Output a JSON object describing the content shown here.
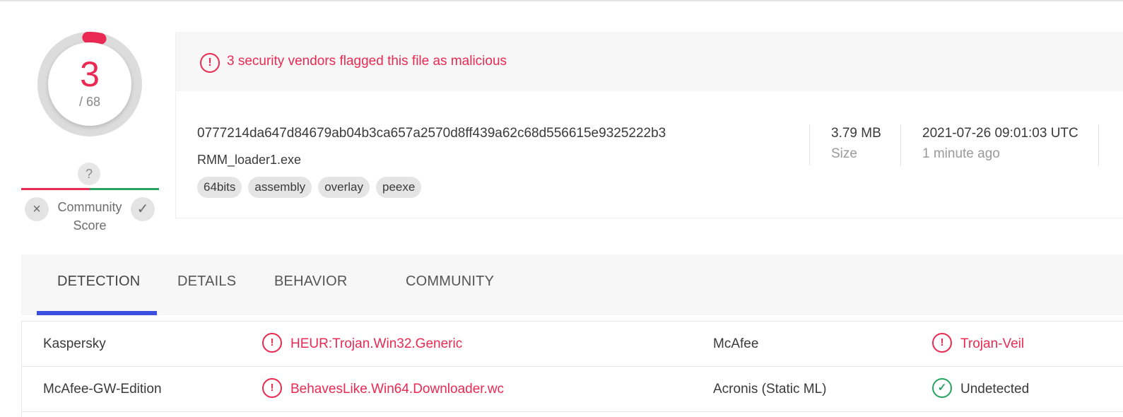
{
  "score": {
    "detected": "3",
    "total": "/ 68",
    "detected_fraction": 0.044
  },
  "community": {
    "question_mark": "?",
    "label_line1": "Community",
    "label_line2": "Score",
    "downvote_icon": "×",
    "upvote_icon": "✓"
  },
  "alert": {
    "icon": "!",
    "text": "3 security vendors flagged this file as malicious"
  },
  "file": {
    "hash": "0777214da647d84679ab04b3ca657a2570d8ff439a62c68d556615e9325222b3",
    "name": "RMM_loader1.exe",
    "tags": [
      "64bits",
      "assembly",
      "overlay",
      "peexe"
    ],
    "size_value": "3.79 MB",
    "size_label": "Size",
    "date_value": "2021-07-26 09:01:03 UTC",
    "date_label": "1 minute ago"
  },
  "tabs": [
    {
      "label": "DETECTION"
    },
    {
      "label": "DETAILS"
    },
    {
      "label": "BEHAVIOR"
    },
    {
      "label": "COMMUNITY"
    }
  ],
  "detections": [
    {
      "vendor1": "Kaspersky",
      "result1": "HEUR:Trojan.Win32.Generic",
      "status1": "malicious",
      "vendor2": "McAfee",
      "result2": "Trojan-Veil",
      "status2": "malicious"
    },
    {
      "vendor1": "McAfee-GW-Edition",
      "result1": "BehavesLike.Win64.Downloader.wc",
      "status1": "malicious",
      "vendor2": "Acronis (Static ML)",
      "result2": "Undetected",
      "status2": "undetected"
    }
  ],
  "icons": {
    "malicious": "!",
    "undetected": "✓"
  },
  "colors": {
    "malicious": "#ea2a52",
    "clean": "#27a361",
    "tab_accent": "#3b4fe0"
  }
}
